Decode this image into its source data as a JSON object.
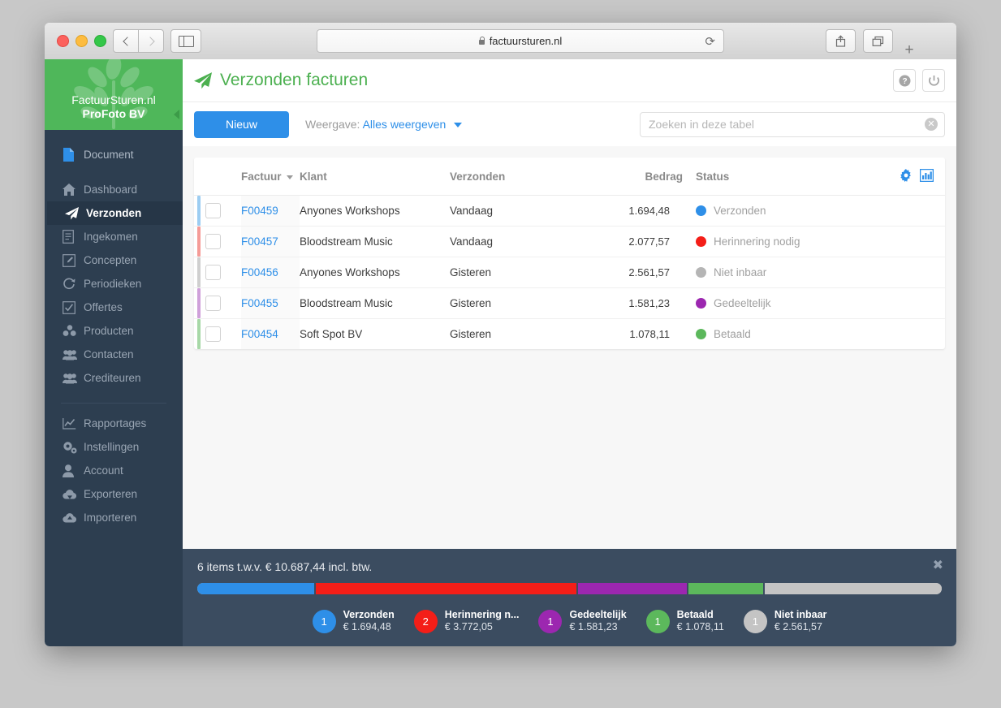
{
  "browser": {
    "url": "factuursturen.nl",
    "lock_icon": "lock-icon",
    "reload_icon": "reload-icon",
    "back_icon": "back-chevron-icon",
    "forward_icon": "forward-chevron-icon",
    "sidebar_icon": "sidebar-toggle-icon",
    "share_icon": "share-icon",
    "tabs_icon": "show-tabs-icon",
    "new_tab_label": "+"
  },
  "sidebar": {
    "logo": {
      "brand": "FactuurSturen.nl",
      "company": "ProFoto BV",
      "collapse_icon": "collapse-arrow-icon"
    },
    "items": [
      {
        "label": "Document",
        "icon": "document-icon",
        "active": false
      },
      {
        "label": "Dashboard",
        "icon": "home-icon",
        "active": false
      },
      {
        "label": "Verzonden",
        "icon": "paper-plane-icon",
        "active": true
      },
      {
        "label": "Ingekomen",
        "icon": "file-lines-icon",
        "active": false
      },
      {
        "label": "Concepten",
        "icon": "pencil-square-icon",
        "active": false
      },
      {
        "label": "Periodieken",
        "icon": "refresh-icon",
        "active": false
      },
      {
        "label": "Offertes",
        "icon": "check-square-icon",
        "active": false
      },
      {
        "label": "Producten",
        "icon": "cubes-icon",
        "active": false
      },
      {
        "label": "Contacten",
        "icon": "users-icon",
        "active": false
      },
      {
        "label": "Crediteuren",
        "icon": "users-icon",
        "active": false
      }
    ],
    "items2": [
      {
        "label": "Rapportages",
        "icon": "chart-line-icon"
      },
      {
        "label": "Instellingen",
        "icon": "gears-icon"
      },
      {
        "label": "Account",
        "icon": "user-icon"
      },
      {
        "label": "Exporteren",
        "icon": "cloud-download-icon"
      },
      {
        "label": "Importeren",
        "icon": "cloud-upload-icon"
      }
    ]
  },
  "header": {
    "title": "Verzonden facturen",
    "title_icon": "paper-plane-icon",
    "help_icon": "help-icon",
    "power_icon": "power-icon",
    "accent_green": "#4cb050"
  },
  "toolbar": {
    "new_label": "Nieuw",
    "view_prefix": "Weergave:",
    "view_value": "Alles weergeven",
    "dropdown_icon": "chevron-down-icon",
    "accent_blue": "#2e8fe8"
  },
  "search": {
    "placeholder": "Zoeken in deze tabel",
    "value": "",
    "clear_icon": "clear-icon",
    "clear_glyph": "✕"
  },
  "table": {
    "columns": [
      {
        "key": "factuur",
        "label": "Factuur",
        "sorted": true
      },
      {
        "key": "klant",
        "label": "Klant"
      },
      {
        "key": "verzonden",
        "label": "Verzonden"
      },
      {
        "key": "bedrag",
        "label": "Bedrag"
      },
      {
        "key": "status",
        "label": "Status"
      }
    ],
    "header_icons": [
      {
        "name": "gear-icon",
        "color": "#2e8fe8"
      },
      {
        "name": "bar-chart-icon",
        "color": "#2e8fe8"
      }
    ],
    "sort_icon": "sort-desc-icon",
    "rows": [
      {
        "factuur": "F00459",
        "klant": "Anyones Workshops",
        "verzonden": "Vandaag",
        "bedrag": "1.694,48",
        "status": "Verzonden",
        "color": "#2e8fe8",
        "mark": "#9ccdf2"
      },
      {
        "factuur": "F00457",
        "klant": "Bloodstream Music",
        "verzonden": "Vandaag",
        "bedrag": "2.077,57",
        "status": "Herinnering nodig",
        "color": "#f41e18",
        "mark": "#f59b97"
      },
      {
        "factuur": "F00456",
        "klant": "Anyones Workshops",
        "verzonden": "Gisteren",
        "bedrag": "2.561,57",
        "status": "Niet inbaar",
        "color": "#b5b5b5",
        "mark": "#cfcfcf"
      },
      {
        "factuur": "F00455",
        "klant": "Bloodstream Music",
        "verzonden": "Gisteren",
        "bedrag": "1.581,23",
        "status": "Gedeeltelijk",
        "color": "#9c27b0",
        "mark": "#cfa0da"
      },
      {
        "factuur": "F00454",
        "klant": "Soft Spot BV",
        "verzonden": "Gisteren",
        "bedrag": "1.078,11",
        "status": "Betaald",
        "color": "#5cb85c",
        "mark": "#a7d8a7"
      }
    ]
  },
  "footer": {
    "summary": "6 items t.w.v. € 10.687,44 incl. btw.",
    "close_icon": "close-icon",
    "close_glyph": "✖",
    "bar": [
      {
        "name": "Verzonden",
        "color": "#2e8fe8",
        "pct": 15.8
      },
      {
        "name": "Herinnering nodig",
        "color": "#f41e18",
        "pct": 35.3
      },
      {
        "name": "Gedeeltelijk",
        "color": "#9c27b0",
        "pct": 14.8
      },
      {
        "name": "Betaald",
        "color": "#5cb85c",
        "pct": 10.1
      },
      {
        "name": "Niet inbaar",
        "color": "#c4c4c4",
        "pct": 24.0
      }
    ],
    "legend": [
      {
        "count": "1",
        "label": "Verzonden",
        "amount": "€ 1.694,48",
        "color": "#2e8fe8"
      },
      {
        "count": "2",
        "label": "Herinnering n...",
        "amount": "€ 3.772,05",
        "color": "#f41e18"
      },
      {
        "count": "1",
        "label": "Gedeeltelijk",
        "amount": "€ 1.581,23",
        "color": "#9c27b0"
      },
      {
        "count": "1",
        "label": "Betaald",
        "amount": "€ 1.078,11",
        "color": "#5cb85c"
      },
      {
        "count": "1",
        "label": "Niet inbaar",
        "amount": "€ 2.561,57",
        "color": "#c4c4c4"
      }
    ]
  }
}
